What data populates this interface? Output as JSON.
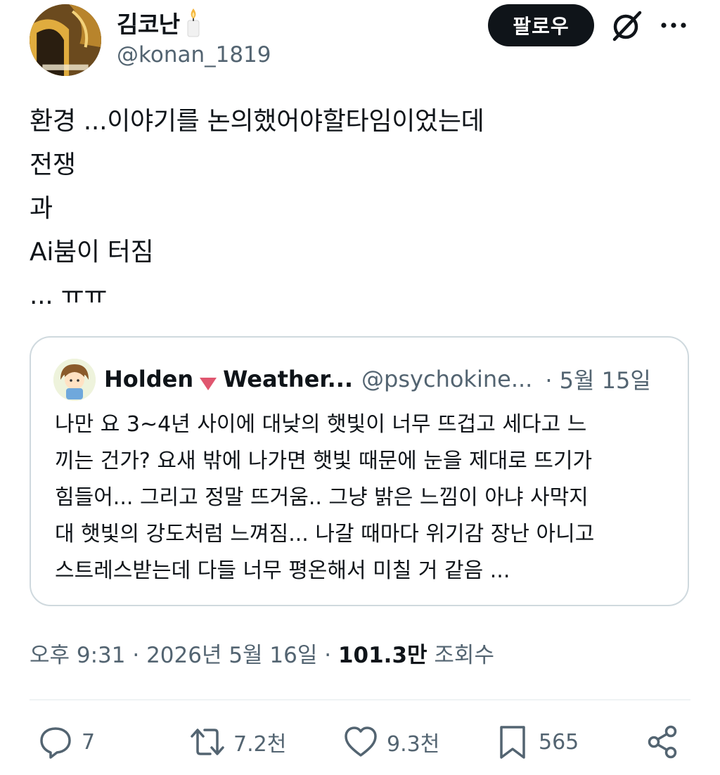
{
  "author": {
    "display_name": "김코난",
    "handle": "@konan_1819",
    "badge_icon": "candle-icon"
  },
  "header": {
    "follow_label": "팔로우",
    "grok_icon": "grok-icon",
    "more_icon": "more-icon"
  },
  "tweet": {
    "lines": [
      "환경 ...이야기를 논의했어야할타임이었는데",
      "전쟁",
      "과",
      "Ai붐이 터짐",
      "... ㅠㅠ"
    ]
  },
  "quote": {
    "name": "Holden",
    "name_suffix": "Weather...",
    "handle": "@psychokine...",
    "date": "· 5월 15일",
    "body_lines": [
      "나만 요 3~4년 사이에 대낮의 햇빛이 너무 뜨겁고 세다고 느",
      "끼는 건가? 요새 밖에 나가면 햇빛 때문에 눈을 제대로 뜨기가",
      "힘들어... 그리고 정말 뜨거움.. 그냥 밝은 느낌이 아냐 사막지",
      "대 햇빛의 강도처럼 느껴짐... 나갈 때마다 위기감 장난 아니고",
      "스트레스받는데 다들 너무 평온해서 미칠 거 같음 ..."
    ]
  },
  "meta": {
    "timestamp": "오후 9:31 · 2026년 5월 16일 · ",
    "views_count": "101.3만",
    "views_label": "조회수"
  },
  "actions": {
    "reply_count": "7",
    "retweet_count": "7.2천",
    "like_count": "9.3천",
    "bookmark_count": "565"
  },
  "colors": {
    "text_primary": "#0f1419",
    "text_secondary": "#536471",
    "border": "#cfd9de",
    "triangle_accent": "#e0566f"
  }
}
